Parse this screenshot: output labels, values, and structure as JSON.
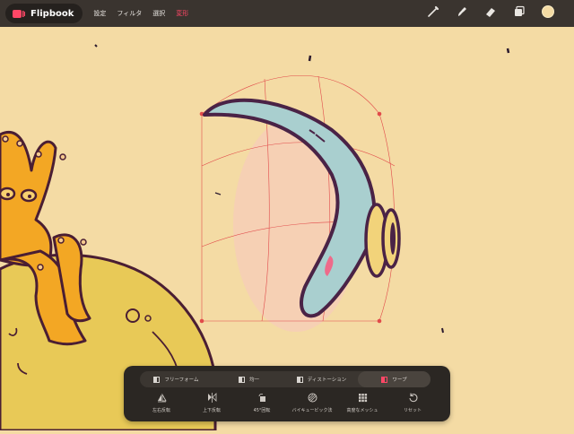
{
  "app": {
    "title": "Flipbook"
  },
  "menu": [
    {
      "label": "設定"
    },
    {
      "label": "フィルタ"
    },
    {
      "label": "選択"
    },
    {
      "label": "変形",
      "active": true
    }
  ],
  "tools": [
    "brush-icon",
    "smudge-icon",
    "eraser-icon",
    "layers-icon",
    "color-swatch"
  ],
  "colors": {
    "accent": "#ff4766",
    "canvas": "#f4dba4",
    "toolbar": "#3a342f"
  },
  "transform_modes": [
    {
      "label": "フリーフォーム"
    },
    {
      "label": "均一"
    },
    {
      "label": "ディストーション"
    },
    {
      "label": "ワープ",
      "selected": true
    }
  ],
  "transform_actions": [
    {
      "label": "左右反転",
      "icon": "flip-horizontal-icon"
    },
    {
      "label": "上下反転",
      "icon": "flip-vertical-icon"
    },
    {
      "label": "45°回転",
      "icon": "rotate-45-icon"
    },
    {
      "label": "バイキュービック法",
      "icon": "bicubic-icon"
    },
    {
      "label": "高度なメッシュ",
      "icon": "mesh-icon"
    },
    {
      "label": "リセット",
      "icon": "reset-icon"
    }
  ]
}
